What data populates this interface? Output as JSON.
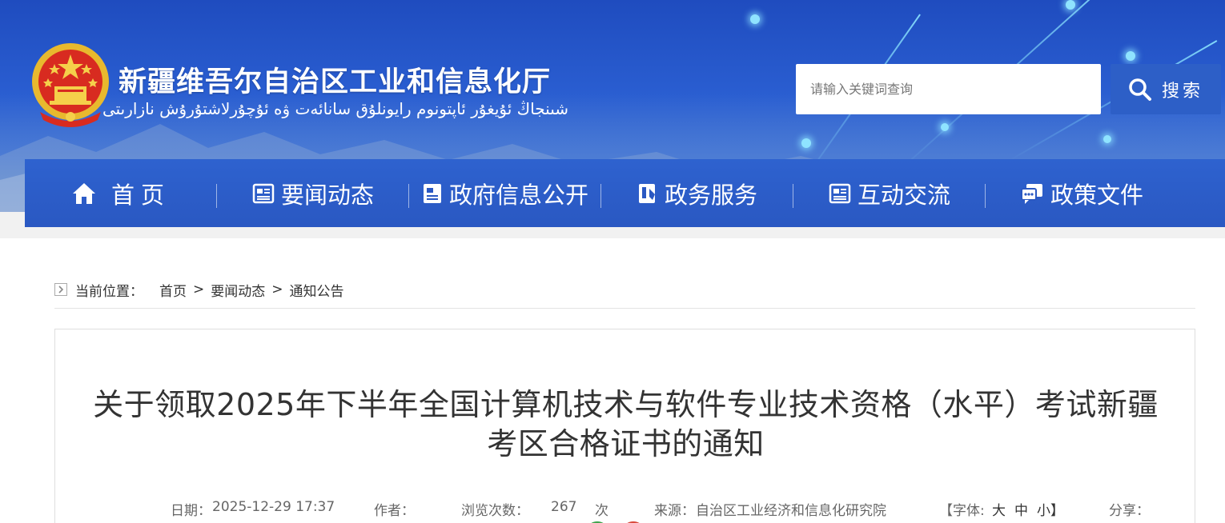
{
  "header": {
    "title": "新疆维吾尔自治区工业和信息化厅",
    "subtitle": "شىنجاڭ ئۇيغۇر ئاپتونوم رايونلۇق سانائەت ۋە ئۇچۇرلاشتۇرۇش نازارىتى",
    "emblem_icon": "national-emblem-icon",
    "search": {
      "placeholder": "请输入关键词查询",
      "button_label": "搜索",
      "icon": "search-icon"
    }
  },
  "nav": {
    "items": [
      {
        "label": "首页",
        "icon": "home-icon"
      },
      {
        "label": "要闻动态",
        "icon": "news-icon"
      },
      {
        "label": "政府信息公开",
        "icon": "document-icon"
      },
      {
        "label": "政务服务",
        "icon": "service-icon"
      },
      {
        "label": "互动交流",
        "icon": "interaction-icon"
      },
      {
        "label": "政策文件",
        "icon": "policy-icon"
      }
    ]
  },
  "breadcrumb": {
    "label": "当前位置：",
    "separator": ">",
    "items": [
      "首页",
      "要闻动态",
      "通知公告"
    ]
  },
  "article": {
    "title": "关于领取2025年下半年全国计算机技术与软件专业技术资格（水平）考试新疆考区合格证书的通知",
    "meta": {
      "date_label": "日期：",
      "date": "2025-12-29 17:37",
      "author_label": "作者：",
      "views_label": "浏览次数：",
      "views": "267",
      "views_unit": "次",
      "source_label": "来源：",
      "source": "自治区工业经济和信息化研究院",
      "font_label": "【字体:",
      "font_large": "大",
      "font_medium": "中",
      "font_small": "小】",
      "share_label": "分享："
    }
  },
  "colors": {
    "banner": "#2a5ed1",
    "nav": "#2e62cf",
    "search_button": "#2d5fc7",
    "share_green": "#3fa34d",
    "share_red": "#d9493b"
  }
}
